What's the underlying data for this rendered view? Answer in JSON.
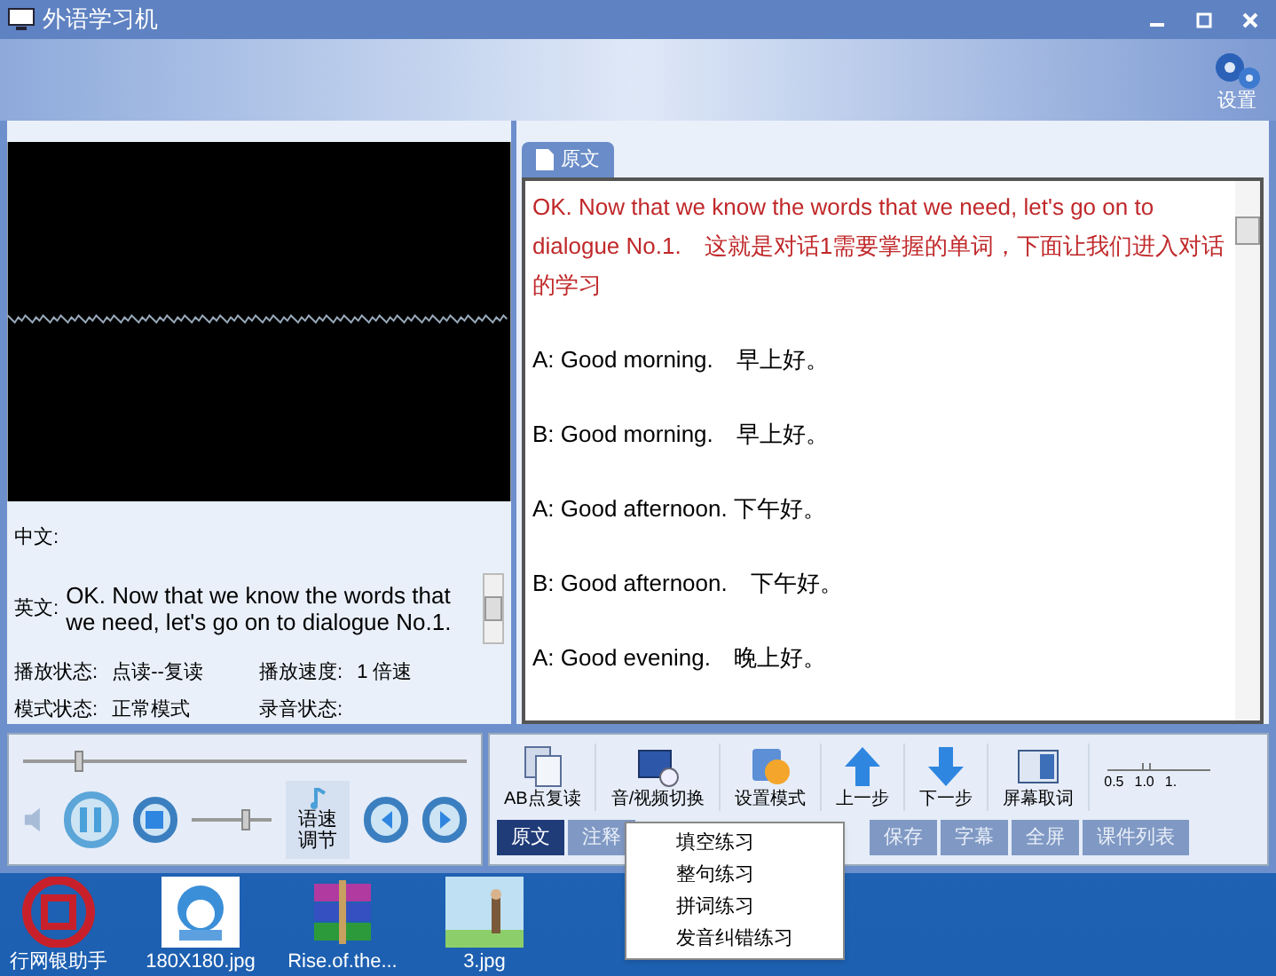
{
  "window": {
    "title": "外语学习机"
  },
  "settings_button": {
    "label": "设置"
  },
  "left_panel": {
    "chinese_label": "中文:",
    "english_label": "英文:",
    "english_text": "OK. Now that we know the words that we need, let's go on to dialogue No.1.",
    "status": [
      {
        "label": "播放状态:",
        "value": "点读--复读"
      },
      {
        "label": "播放速度:",
        "value": "1  倍速"
      },
      {
        "label": "模式状态:",
        "value": "正常模式"
      },
      {
        "label": "录音状态:"
      }
    ]
  },
  "player": {
    "progress": {
      "level": 0.12
    },
    "volume": {
      "level": 0.7
    },
    "speed_button": "语速调节"
  },
  "document_tab": {
    "label": "原文"
  },
  "transcript": [
    {
      "text": "OK. Now that we know the words that we need, let's go on to dialogue No.1.　这就是对话1需要掌握的单词，下面让我们进入对话的学习",
      "highlighted": true
    },
    {
      "text": "A: Good morning.　早上好。",
      "highlighted": false
    },
    {
      "text": "B: Good morning.　早上好。",
      "highlighted": false
    },
    {
      "text": "A: Good afternoon.  下午好。",
      "highlighted": false
    },
    {
      "text": "B: Good afternoon.　下午好。",
      "highlighted": false
    },
    {
      "text": "A: Good evening.　晚上好。",
      "highlighted": false
    }
  ],
  "toolbar": [
    {
      "kind": "ab",
      "label": "AB点复读"
    },
    {
      "kind": "switch",
      "label": "音/视频切换"
    },
    {
      "kind": "mode",
      "label": "设置模式"
    },
    {
      "kind": "up",
      "label": "上一步"
    },
    {
      "kind": "down",
      "label": "下一步"
    },
    {
      "kind": "screen",
      "label": "屏幕取词"
    }
  ],
  "speed_scale": [
    "0.5",
    "1.0",
    "1."
  ],
  "bottom_tabs": [
    {
      "label": "原文",
      "selected": true
    },
    {
      "label": "注释",
      "selected": false
    },
    {
      "label": "保存",
      "selected": false
    },
    {
      "label": "字幕",
      "selected": false
    },
    {
      "label": "全屏",
      "selected": false
    },
    {
      "label": "课件列表",
      "selected": false
    }
  ],
  "popup_menu": [
    "填空练习",
    "整句练习",
    "拼词练习",
    "发音纠错练习"
  ],
  "desktop_icons": [
    {
      "kind": "bank",
      "label": "行网银助手"
    },
    {
      "label": "180X180.jpg"
    },
    {
      "kind": "archive",
      "label": "Rise.of.the..."
    },
    {
      "kind": "image2",
      "label": "3.jpg"
    }
  ]
}
